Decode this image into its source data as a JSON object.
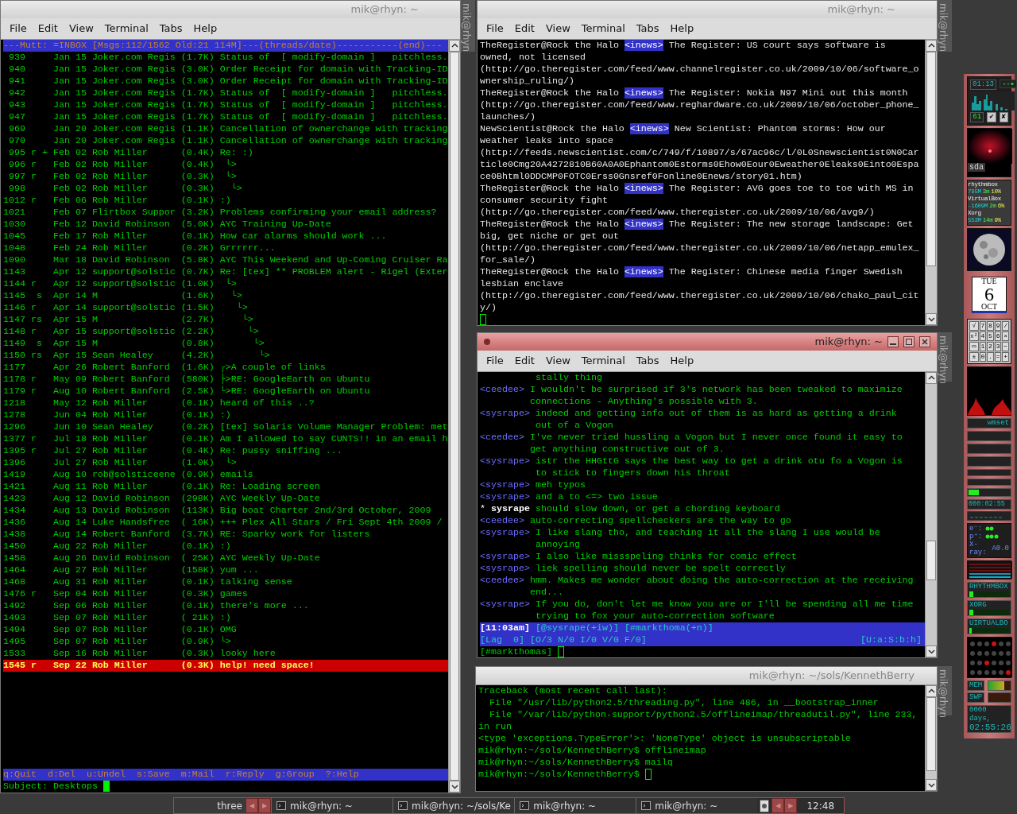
{
  "windows": [
    {
      "kind": "mutt",
      "title": "mik@rhyn: ~",
      "side_label": "mik@rhyn",
      "active": false,
      "menu": [
        "File",
        "Edit",
        "View",
        "Terminal",
        "Tabs",
        "Help"
      ],
      "header": "---Mutt: =INBOX [Msgs:112/1562 Old:21 114M]---(threads/date)-----------(end)---",
      "rows": [
        {
          "num": "939",
          "date": "Jan 15",
          "sender": "Joker.com Regis",
          "size": "(1.7K)",
          "subject": "Status of  [ modify-domain ]   pitchless.",
          "selected": false
        },
        {
          "num": "940",
          "date": "Jan 15",
          "sender": "Joker.com Regis",
          "size": "(3.0K)",
          "subject": "Order Receipt for domain with Tracking-ID",
          "selected": false
        },
        {
          "num": "941",
          "date": "Jan 15",
          "sender": "Joker.com Regis",
          "size": "(3.0K)",
          "subject": "Order Receipt for domain with Tracking-ID",
          "selected": false
        },
        {
          "num": "942",
          "date": "Jan 15",
          "sender": "Joker.com Regis",
          "size": "(1.7K)",
          "subject": "Status of  [ modify-domain ]   pitchless.",
          "selected": false
        },
        {
          "num": "943",
          "date": "Jan 15",
          "sender": "Joker.com Regis",
          "size": "(1.7K)",
          "subject": "Status of  [ modify-domain ]   pitchless.",
          "selected": false
        },
        {
          "num": "947",
          "date": "Jan 15",
          "sender": "Joker.com Regis",
          "size": "(1.7K)",
          "subject": "Status of  [ modify-domain ]   pitchless.",
          "selected": false
        },
        {
          "num": "969",
          "date": "Jan 20",
          "sender": "Joker.com Regis",
          "size": "(1.1K)",
          "subject": "Cancellation of ownerchange with tracking",
          "selected": false
        },
        {
          "num": "970",
          "date": "Jan 20",
          "sender": "Joker.com Regis",
          "size": "(1.1K)",
          "subject": "Cancellation of ownerchange with tracking",
          "selected": false
        },
        {
          "num": "995",
          "flags": "r +",
          "date": "Feb 02",
          "sender": "Rob Miller",
          "size": "(0.4K)",
          "subject": "Re: :)",
          "selected": false
        },
        {
          "num": "996",
          "flags": "r",
          "date": "Feb 02",
          "sender": "Rob Miller",
          "size": "(0.4K)",
          "subject": " └>",
          "selected": false
        },
        {
          "num": "997",
          "flags": "r",
          "date": "Feb 02",
          "sender": "Rob Miller",
          "size": "(0.3K)",
          "subject": " └>",
          "selected": false
        },
        {
          "num": "998",
          "date": "Feb 02",
          "sender": "Rob Miller",
          "size": "(0.3K)",
          "subject": "  └>",
          "selected": false
        },
        {
          "num": "1012",
          "flags": "r",
          "date": "Feb 06",
          "sender": "Rob Miller",
          "size": "(0.1K)",
          "subject": ":)",
          "selected": false
        },
        {
          "num": "1021",
          "date": "Feb 07",
          "sender": "Flirtbox Suppor",
          "size": "(3.2K)",
          "subject": "Problems confirming your email address?",
          "selected": false
        },
        {
          "num": "1030",
          "date": "Feb 12",
          "sender": "David Robinson",
          "size": "(5.0K)",
          "subject": "AYC Training Up-Date",
          "selected": false
        },
        {
          "num": "1045",
          "date": "Feb 17",
          "sender": "Rob Miller",
          "size": "(0.1K)",
          "subject": "How car alarms should work ...",
          "selected": false
        },
        {
          "num": "1048",
          "date": "Feb 24",
          "sender": "Rob Miller",
          "size": "(0.2K)",
          "subject": "Grrrrrr...",
          "selected": false
        },
        {
          "num": "1090",
          "date": "Mar 18",
          "sender": "David Robinson",
          "size": "(5.8K)",
          "subject": "AYC This Weekend and Up-Coming Cruiser Ra",
          "selected": false
        },
        {
          "num": "1143",
          "date": "Apr 12",
          "sender": "support@solstic",
          "size": "(0.7K)",
          "subject": "Re: [tex] ** PROBLEM alert - Rigel (Exter",
          "selected": false
        },
        {
          "num": "1144",
          "flags": "r",
          "date": "Apr 12",
          "sender": "support@solstic",
          "size": "(1.0K)",
          "subject": " └>",
          "selected": false
        },
        {
          "num": "1145",
          "flags": " s",
          "date": "Apr 14",
          "sender": "M",
          "size": "(1.6K)",
          "subject": "  └>",
          "selected": false
        },
        {
          "num": "1146",
          "flags": "r",
          "date": "Apr 14",
          "sender": "support@solstic",
          "size": "(1.5K)",
          "subject": "   └>",
          "selected": false
        },
        {
          "num": "1147",
          "flags": "rs",
          "date": "Apr 15",
          "sender": "M",
          "size": "(2.7K)",
          "subject": "    └>",
          "selected": false
        },
        {
          "num": "1148",
          "flags": "r",
          "date": "Apr 15",
          "sender": "support@solstic",
          "size": "(2.2K)",
          "subject": "     └>",
          "selected": false
        },
        {
          "num": "1149",
          "flags": " s",
          "date": "Apr 15",
          "sender": "M",
          "size": "(0.8K)",
          "subject": "      └>",
          "selected": false
        },
        {
          "num": "1150",
          "flags": "rs",
          "date": "Apr 15",
          "sender": "Sean Healey",
          "size": "(4.2K)",
          "subject": "       └>",
          "selected": false
        },
        {
          "num": "1177",
          "date": "Apr 26",
          "sender": "Robert Banford",
          "size": "(1.6K)",
          "subject": "┌>A couple of links",
          "selected": false
        },
        {
          "num": "1178",
          "flags": "r",
          "date": "May 09",
          "sender": "Robert Banford",
          "size": "(580K)",
          "subject": "├>RE: GoogleEarth on Ubuntu",
          "selected": false
        },
        {
          "num": "1179",
          "flags": "r",
          "date": "Aug 10",
          "sender": "Robert Banford",
          "size": "(2.5K)",
          "subject": "└>RE: GoogleEarth on Ubuntu",
          "selected": false
        },
        {
          "num": "1218",
          "date": "May 12",
          "sender": "Rob Miller",
          "size": "(0.1K)",
          "subject": "heard of this ..?",
          "selected": false
        },
        {
          "num": "1278",
          "date": "Jun 04",
          "sender": "Rob Miller",
          "size": "(0.1K)",
          "subject": ":)",
          "selected": false
        },
        {
          "num": "1296",
          "date": "Jun 10",
          "sender": "Sean Healey",
          "size": "(0.2K)",
          "subject": "[tex] Solaris Volume Manager Problem: met",
          "selected": false
        },
        {
          "num": "1377",
          "flags": "r",
          "date": "Jul 18",
          "sender": "Rob Miller",
          "size": "(0.1K)",
          "subject": "Am I allowed to say CUNTS!! in an email h",
          "selected": false
        },
        {
          "num": "1395",
          "flags": "r",
          "date": "Jul 27",
          "sender": "Rob Miller",
          "size": "(0.4K)",
          "subject": "Re: pussy sniffing ...",
          "selected": false
        },
        {
          "num": "1396",
          "date": "Jul 27",
          "sender": "Rob Miller",
          "size": "(1.0K)",
          "subject": " └>",
          "selected": false
        },
        {
          "num": "1419",
          "date": "Aug 10",
          "sender": "rob@solsticeene",
          "size": "(0.9K)",
          "subject": "emails",
          "selected": false
        },
        {
          "num": "1421",
          "date": "Aug 11",
          "sender": "Rob Miller",
          "size": "(0.1K)",
          "subject": "Re: Loading screen",
          "selected": false
        },
        {
          "num": "1423",
          "date": "Aug 12",
          "sender": "David Robinson",
          "size": "(298K)",
          "subject": "AYC Weekly Up-Date",
          "selected": false
        },
        {
          "num": "1434",
          "date": "Aug 13",
          "sender": "David Robinson",
          "size": "(113K)",
          "subject": "Big boat Charter 2nd/3rd October, 2009",
          "selected": false
        },
        {
          "num": "1436",
          "date": "Aug 14",
          "sender": "Luke Handsfree",
          "size": "( 16K)",
          "subject": "+++ Plex All Stars / Fri Sept 4th 2009 /",
          "selected": false
        },
        {
          "num": "1438",
          "date": "Aug 14",
          "sender": "Robert Banford",
          "size": "(3.7K)",
          "subject": "RE: Sparky work for listers",
          "selected": false
        },
        {
          "num": "1450",
          "date": "Aug 22",
          "sender": "Rob Miller",
          "size": "(0.1K)",
          "subject": ":)",
          "selected": false
        },
        {
          "num": "1458",
          "date": "Aug 26",
          "sender": "David Robinson",
          "size": "( 25K)",
          "subject": "AYC Weekly Up-Date",
          "selected": false
        },
        {
          "num": "1464",
          "date": "Aug 27",
          "sender": "Rob Miller",
          "size": "(158K)",
          "subject": "yum ...",
          "selected": false
        },
        {
          "num": "1468",
          "date": "Aug 31",
          "sender": "Rob Miller",
          "size": "(0.1K)",
          "subject": "talking sense",
          "selected": false
        },
        {
          "num": "1476",
          "flags": "r",
          "date": "Sep 04",
          "sender": "Rob Miller",
          "size": "(0.3K)",
          "subject": "games",
          "selected": false
        },
        {
          "num": "1492",
          "date": "Sep 06",
          "sender": "Rob Miller",
          "size": "(0.1K)",
          "subject": "there's more ...",
          "selected": false
        },
        {
          "num": "1493",
          "date": "Sep 07",
          "sender": "Rob Miller",
          "size": "( 21K)",
          "subject": ":)",
          "selected": false
        },
        {
          "num": "1494",
          "date": "Sep 07",
          "sender": "Rob Miller",
          "size": "(0.1K)",
          "subject": "OMG",
          "selected": false
        },
        {
          "num": "1495",
          "date": "Sep 07",
          "sender": "Rob Miller",
          "size": "(0.9K)",
          "subject": "└>",
          "selected": false
        },
        {
          "num": "1533",
          "date": "Sep 16",
          "sender": "Rob Miller",
          "size": "(0.3K)",
          "subject": "looky here",
          "selected": false
        },
        {
          "num": "1545",
          "flags": "r",
          "date": "Sep 22",
          "sender": "Rob Miller",
          "size": "(0.3K)",
          "subject": "help! need space!",
          "selected": true
        }
      ],
      "footer": "q:Quit  d:Del  u:Undel  s:Save  m:Mail  r:Reply  g:Group  ?:Help",
      "prompt": "Subject: Desktops",
      "cursor_solid": true
    },
    {
      "kind": "news",
      "title": "mik@rhyn: ~",
      "side_label": "mik@rhyn",
      "active": false,
      "menu": [
        "File",
        "Edit",
        "View",
        "Terminal",
        "Tabs",
        "Help"
      ],
      "entries": [
        {
          "source": "TheRegister@Rock the Halo",
          "tag": "<inews>",
          "lines": [
            "The Register: US court says software is",
            "owned, not licensed",
            "(http://go.theregister.com/feed/www.channelregister.co.uk/2009/10/06/software_o",
            "wnership_ruling/)"
          ]
        },
        {
          "source": "TheRegister@Rock the Halo",
          "tag": "<inews>",
          "lines": [
            "The Register: Nokia N97 Mini out this month",
            "(http://go.theregister.com/feed/www.reghardware.co.uk/2009/10/06/october_phone_",
            "launches/)"
          ]
        },
        {
          "source": "NewScientist@Rock the Halo",
          "tag": "<inews>",
          "lines": [
            "New Scientist: Phantom storms: How our",
            "weather leaks into space",
            "(http://feeds.newscientist.com/c/749/f/10897/s/67ac96c/l/0L0Snewscientist0N0Car",
            "ticle0Cmg20A4272810B60A0A0Ephantom0Estorms0Ehow0Eour0Eweather0Eleaks0Einto0Espa",
            "ce0Bhtml0DDCMP0FOTC0Erss0Gnsref0Fonline0Enews/story01.htm)"
          ]
        },
        {
          "source": "TheRegister@Rock the Halo",
          "tag": "<inews>",
          "lines": [
            "The Register: AVG goes toe to toe with MS in",
            "consumer security fight",
            "(http://go.theregister.com/feed/www.theregister.co.uk/2009/10/06/avg9/)"
          ]
        },
        {
          "source": "TheRegister@Rock the Halo",
          "tag": "<inews>",
          "lines": [
            "The Register: The new storage landscape: Get",
            "big, get niche or get out",
            "(http://go.theregister.com/feed/www.theregister.co.uk/2009/10/06/netapp_emulex_",
            "for_sale/)"
          ]
        },
        {
          "source": "TheRegister@Rock the Halo",
          "tag": "<inews>",
          "lines": [
            "The Register: Chinese media finger Swedish",
            "lesbian enclave",
            "(http://go.theregister.com/feed/www.theregister.co.uk/2009/10/06/chako_paul_cit",
            "y/)"
          ]
        }
      ],
      "cursor_solid": false
    },
    {
      "kind": "irc",
      "title": "mik@rhyn: ~",
      "side_label": "mik@rhyn",
      "active": true,
      "menu": [
        "File",
        "Edit",
        "View",
        "Terminal",
        "Tabs",
        "Help"
      ],
      "lines": [
        {
          "kind": "continuation",
          "text": "stally thing"
        },
        {
          "kind": "message",
          "nick": "<ceedee>",
          "lines": [
            "I wouldn't be surprised if 3's network has been tweaked to maximize",
            "connections - Anything's possible with 3."
          ]
        },
        {
          "kind": "message",
          "nick": "<sysrape>",
          "lines": [
            "indeed and getting info out of them is as hard as getting a drink",
            "out of a Vogon"
          ]
        },
        {
          "kind": "message",
          "nick": "<ceedee>",
          "lines": [
            "I've never tried hussling a Vogon but I never once found it easy to",
            "get anything constructive out of 3."
          ]
        },
        {
          "kind": "message",
          "nick": "<sysrape>",
          "lines": [
            "istr the HHGttG says the best way to get a drink otu fo a Vogon is",
            "to stick to fingers down his throat"
          ]
        },
        {
          "kind": "message",
          "nick": "<sysrape>",
          "lines": [
            "meh typos"
          ]
        },
        {
          "kind": "message",
          "nick": "<sysrape>",
          "lines": [
            "and a to <=> two issue"
          ]
        },
        {
          "kind": "action",
          "marker": "*",
          "nick": "sysrape",
          "lines": [
            "should slow down, or get a chording keyboard"
          ]
        },
        {
          "kind": "message",
          "nick": "<ceedee>",
          "lines": [
            "auto-correcting spellcheckers are the way to go"
          ]
        },
        {
          "kind": "message",
          "nick": "<sysrape>",
          "lines": [
            "I like slang tho, and teaching it all the slang I use would be",
            "annoying"
          ]
        },
        {
          "kind": "message",
          "nick": "<sysrape>",
          "lines": [
            "I also like missspeling thinks for comic effect"
          ]
        },
        {
          "kind": "message",
          "nick": "<sysrape>",
          "lines": [
            "liek spelling should never be spelt correctly"
          ]
        },
        {
          "kind": "message",
          "nick": "<ceedee>",
          "lines": [
            "hmm. Makes me wonder about doing the auto-correction at the receiving",
            "end..."
          ]
        },
        {
          "kind": "message",
          "nick": "<sysrape>",
          "lines": [
            "If you do, don't let me know you are or I'll be spending all me time",
            "trying to fox your auto-correction software"
          ]
        }
      ],
      "status": [
        [
          "[11:03am]",
          "[@sysrape(+iw)]",
          "[#markthoma(+n)]"
        ],
        [
          "[Lag  0]",
          "[O/3 N/0 I/0 V/0 F/0]"
        ]
      ],
      "status_right": "[U:a:S:b:h]",
      "prompt": "[#markthomas]",
      "cursor_solid": false
    },
    {
      "kind": "shell",
      "title": "mik@rhyn: ~/sols/KennethBerry",
      "side_label": "mik@rhyn",
      "active": false,
      "lines": [
        "Traceback (most recent call last):",
        "  File \"/usr/lib/python2.5/threading.py\", line 486, in __bootstrap_inner",
        "  File \"/var/lib/python-support/python2.5/offlineimap/threadutil.py\", line 233,",
        "in run",
        "<type 'exceptions.TypeError'>: 'NoneType' object is unsubscriptable",
        "mik@rhyn:~/sols/KennethBerry$ offlineimap",
        "mik@rhyn:~/sols/KennethBerry$ mailq",
        "mik@rhyn:~/sols/KennethBerry$"
      ],
      "cursor_solid": false
    }
  ],
  "dock": [
    {
      "kind": "clock",
      "time": "01:13",
      "counter": "61",
      "buttons": [
        "✔",
        "✘"
      ]
    },
    {
      "kind": "disk",
      "label": "sda"
    },
    {
      "kind": "top",
      "processes": [
        {
          "name": "rhythmbox",
          "mem": "795M",
          "time": "3m",
          "cpu": "10%"
        },
        {
          "name": "VirtualBox",
          "mem": "-1609M",
          "time": "2m",
          "cpu": "6%"
        },
        {
          "name": "Xorg",
          "mem": "553M",
          "time": "14m",
          "cpu": "9%"
        }
      ]
    },
    {
      "kind": "moon"
    },
    {
      "kind": "calendar",
      "weekday": "TUE",
      "day": "6",
      "month": "OCT"
    },
    {
      "kind": "calculator",
      "keys": [
        "√",
        "7",
        "8",
        "9",
        "/",
        "x²",
        "4",
        "5",
        "6",
        "×",
        "▭",
        "1",
        "2",
        "3",
        "−",
        "±",
        "0",
        ".",
        "=",
        "+"
      ]
    },
    {
      "kind": "fire"
    },
    {
      "kind": "wmset",
      "label": "wmset",
      "level": 0.25
    },
    {
      "kind": "timer",
      "time": "000:02:55"
    },
    {
      "kind": "radiation",
      "labels": [
        "e⁻:",
        "p⁺:",
        "X-ray:"
      ],
      "value": "A0.0"
    },
    {
      "kind": "equalizer"
    },
    {
      "kind": "load",
      "processes": [
        {
          "name": "RHYTHMBOX",
          "level": 0.1
        },
        {
          "name": "XORG",
          "level": 0.1
        },
        {
          "name": "UIRTUALBO",
          "level": 0.06
        }
      ]
    },
    {
      "kind": "lights"
    },
    {
      "kind": "memory",
      "bars": [
        {
          "label": "MEM",
          "level": 0.7
        },
        {
          "label": "SWP"
        }
      ]
    },
    {
      "kind": "uptime",
      "days": "0000 days,",
      "time": "02:55:26"
    }
  ],
  "taskbar": {
    "workspace": "three",
    "pager_arrows": [
      "◀",
      "▶"
    ],
    "tasks": [
      "mik@rhyn: ~",
      "mik@rhyn: ~/sols/Ke",
      "mik@rhyn: ~",
      "mik@rhyn: ~"
    ],
    "tray_arrows": [
      "◀",
      "▶"
    ],
    "clock": "12:48"
  }
}
